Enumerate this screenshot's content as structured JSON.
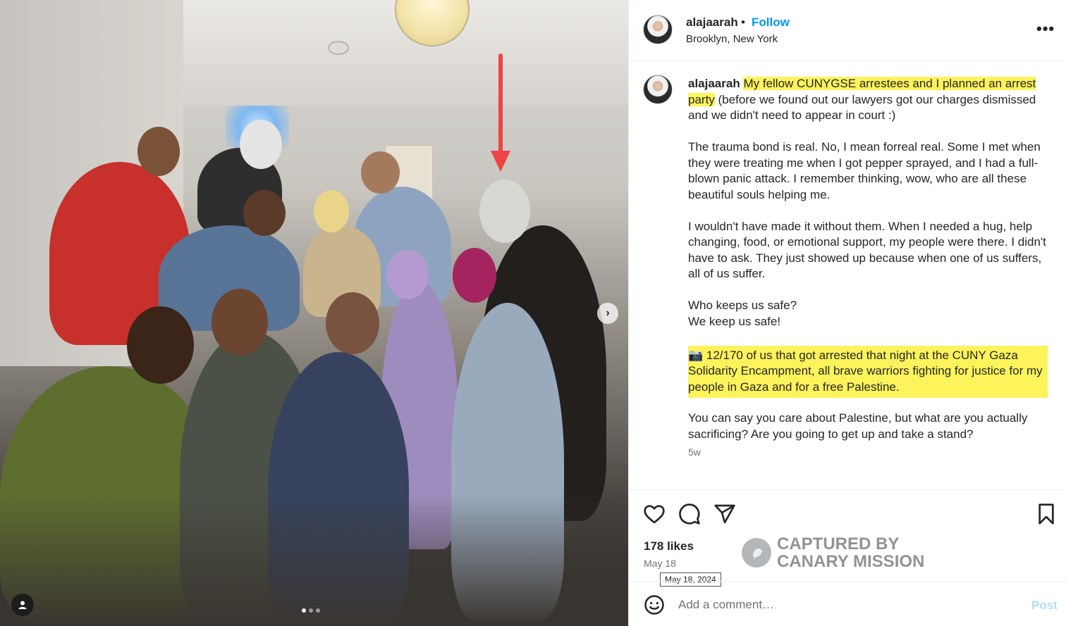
{
  "header": {
    "username": "alajaarah",
    "separator": "•",
    "follow_label": "Follow",
    "location": "Brooklyn, New York",
    "more_icon": "ellipsis-horizontal-icon"
  },
  "caption": {
    "username": "alajaarah",
    "highlight_1": "My fellow CUNYGSE arrestees and I planned an arrest party",
    "text_1": " (before we found out our lawyers got our charges dismissed and we didn't need to appear in court :)",
    "para_2": "The trauma bond is real. No, I mean forreal real. Some I met when they were treating me when I got pepper sprayed, and I had a full-blown panic attack. I remember thinking, wow, who are all these beautiful souls helping me.",
    "para_3": "I wouldn't have made it without them. When I needed a hug, help changing, food, or emotional support, my people were there. I didn't have to ask. They just showed up because when one of us suffers, all of us suffer.",
    "para_4_line_1": "Who keeps us safe?",
    "para_4_line_2": "We keep us safe!",
    "highlight_2": "📷 12/170 of us that got arrested that night at the CUNY Gaza Solidarity Encampment, all brave warriors fighting for justice for my people in Gaza and for a free Palestine.",
    "para_6": "You can say you care about Palestine, but what are you actually sacrificing? Are you going to get up and take a stand?",
    "time_ago": "5w"
  },
  "actions": {
    "icons": [
      "heart-icon",
      "comment-icon",
      "share-icon",
      "bookmark-icon"
    ],
    "likes": "178 likes",
    "date": "May 18",
    "date_tooltip": "May 18, 2024"
  },
  "watermark": {
    "line_1": "CAPTURED BY",
    "line_2": "CANARY MISSION"
  },
  "comment": {
    "placeholder": "Add a comment…",
    "post_label": "Post"
  },
  "carousel": {
    "slide_count": 3,
    "active_index": 0
  },
  "colors": {
    "follow": "#0095f6",
    "highlight": "#fdf35a",
    "arrow": "#ef4444",
    "post_disabled": "#b3dbff"
  }
}
